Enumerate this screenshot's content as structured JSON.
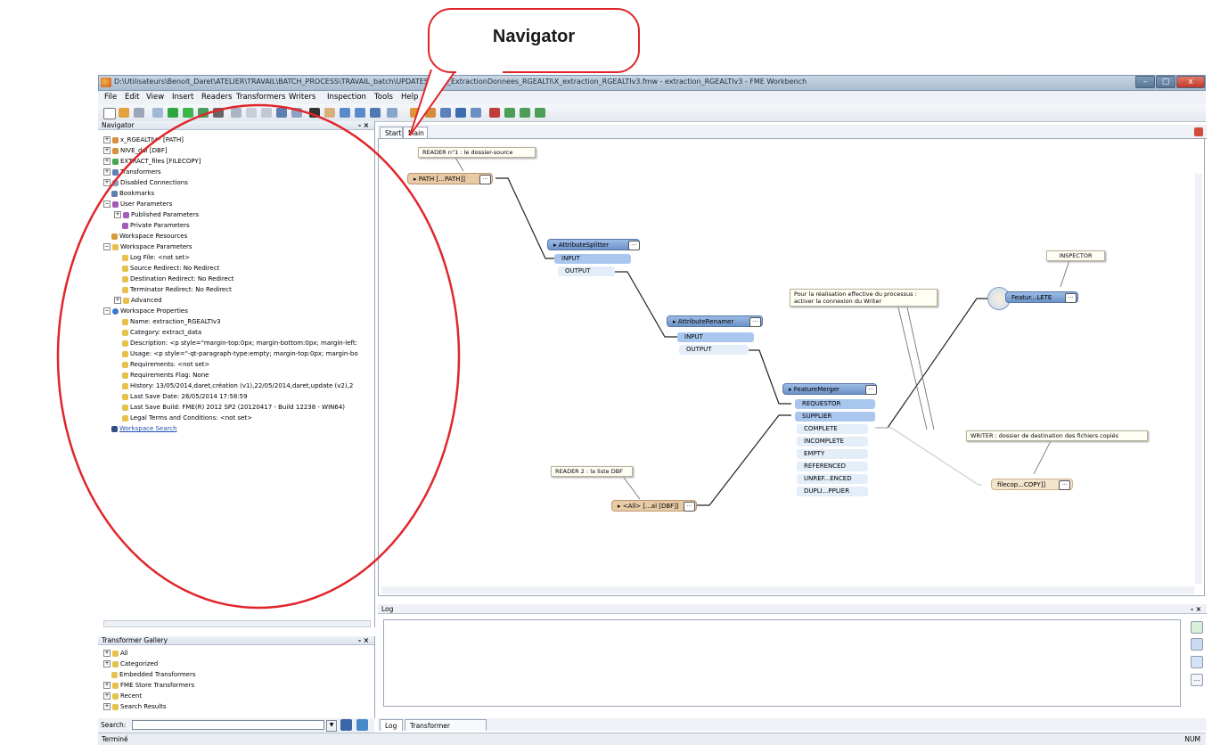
{
  "callout": {
    "label": "Navigator"
  },
  "window": {
    "title": "D:\\Utilisateurs\\Benoit_Daret\\ATELIER\\TRAVAIL\\BATCH_PROCESS\\TRAVAIL_batch\\UPDATES_vers_ExtractionDonnees_RGEALTI\\X_extraction_RGEALTIv3.fmw - extraction_RGEALTIv3 - FME Workbench",
    "controls": {
      "minimize": "–",
      "maximize": "▢",
      "close": "x"
    }
  },
  "menu": {
    "items": [
      "File",
      "Edit",
      "View",
      "Insert",
      "Readers",
      "Transformers",
      "Writers",
      "Inspection",
      "Tools",
      "Help"
    ]
  },
  "navigator": {
    "title": "Navigator",
    "close": "- ×",
    "items": [
      "x_RGEALTI\\** [PATH]",
      "NIVE_dal [DBF]",
      "EXTRACT_files [FILECOPY]",
      "Transformers",
      "Disabled Connections",
      "Bookmarks",
      "User Parameters",
      "Published Parameters",
      "Private Parameters",
      "Workspace Resources",
      "Workspace Parameters",
      "Log File: <not set>",
      "Source Redirect: No Redirect",
      "Destination Redirect: No Redirect",
      "Terminator Redirect: No Redirect",
      "Advanced",
      "Workspace Properties",
      "Name: extraction_RGEALTIv3",
      "Category: extract_data",
      "Description: <p style=\"margin-top:0px; margin-bottom:0px; margin-left:",
      "Usage: <p style=\"-qt-paragraph-type:empty; margin-top:0px; margin-bo",
      "Requirements: <not set>",
      "Requirements Flag: None",
      "History: 13/05/2014,daret,création (v1),22/05/2014,daret,update (v2),2",
      "Last Save Date: 26/05/2014 17:58:59",
      "Last Save Build: FME(R) 2012 SP2 (20120417 - Build 12238 - WIN64)",
      "Legal Terms and Conditions: <not set>",
      "Workspace Search"
    ]
  },
  "gallery": {
    "title": "Transformer Gallery",
    "close": "- ×",
    "items": [
      "All",
      "Categorized",
      "Embedded Transformers",
      "FME Store Transformers",
      "Recent",
      "Search Results"
    ],
    "search_label": "Search:"
  },
  "canvas": {
    "tabs": [
      "Start",
      "Main"
    ],
    "notes": {
      "reader1": "READER n°1 : le dossier-source",
      "reader2": "READER 2 : la liste DBF",
      "inspector": "INSPECTOR",
      "writer_note": "Pour la réalisation effective du processus : activer la connexion du Writer",
      "writer": "WRITER : dossier de destination des fichiers copiés"
    },
    "nodes": {
      "path_reader": "PATH [...PATH]]",
      "splitter": "AttributeSplitter",
      "splitter_ports": [
        "INPUT",
        "OUTPUT"
      ],
      "renamer": "AttributeRenamer",
      "renamer_ports": [
        "INPUT",
        "OUTPUT"
      ],
      "merger": "FeatureMerger",
      "merger_inputs": [
        "REQUESTOR",
        "SUPPLIER"
      ],
      "merger_outputs": [
        "COMPLETE",
        "INCOMPLETE",
        "EMPTY",
        "REFERENCED",
        "UNREF...ENCED",
        "DUPLI...PPLIER"
      ],
      "dbf_reader": "<All> [...al [DBF]]",
      "inspector_node": "Featur...LETE",
      "writer_node": "filecop...COPY]]"
    },
    "ellipsis": "..."
  },
  "log": {
    "title": "Log",
    "tabs": [
      "Log",
      "Transformer Description"
    ],
    "close": "- ×"
  },
  "status": {
    "left": "Terminé",
    "right": "NUM"
  },
  "colors": {
    "annotation_red": "#e0262b",
    "node_blue": "#7da4d6",
    "reader_tan": "#e8cba6"
  }
}
